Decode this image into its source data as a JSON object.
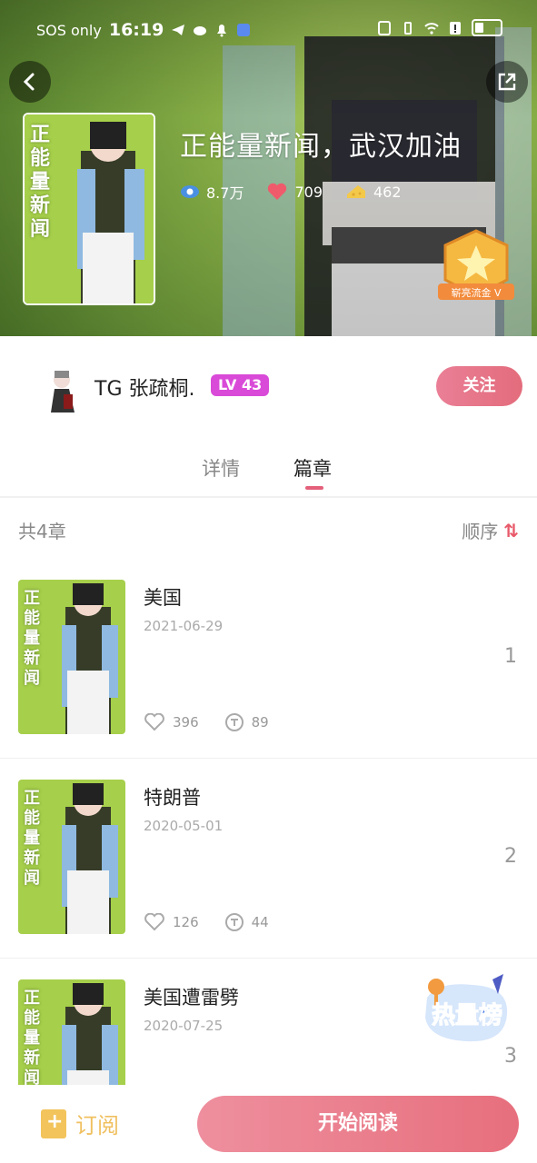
{
  "status_bar": {
    "carrier": "SOS only",
    "time": "16:19"
  },
  "header": {
    "title": "正能量新闻，武汉加油",
    "stats": {
      "views": "8.7万",
      "likes": "709",
      "coins": "462"
    },
    "medal_label": "崭亮流金 V",
    "cover_text": "正能量新闻"
  },
  "author": {
    "name": "TG 张疏桐.",
    "level": "LV 43",
    "follow_label": "关注"
  },
  "tabs": [
    {
      "label": "详情"
    },
    {
      "label": "篇章"
    }
  ],
  "chapters_header": {
    "count": "共4章",
    "order_label": "顺序"
  },
  "chapters": [
    {
      "title": "美国",
      "date": "2021-06-29",
      "likes": "396",
      "comments": "89",
      "index": "1"
    },
    {
      "title": "特朗普",
      "date": "2020-05-01",
      "likes": "126",
      "comments": "44",
      "index": "2"
    },
    {
      "title": "美国遭雷劈",
      "date": "2020-07-25",
      "likes": "",
      "comments": "",
      "index": "3"
    }
  ],
  "hot_badge": "热量榜",
  "bottom_bar": {
    "subscribe_label": "订阅",
    "start_label": "开始阅读"
  },
  "colors": {
    "accent": "#e36c7c",
    "level_badge": "#d94ad8",
    "subscribe": "#f0c060"
  }
}
